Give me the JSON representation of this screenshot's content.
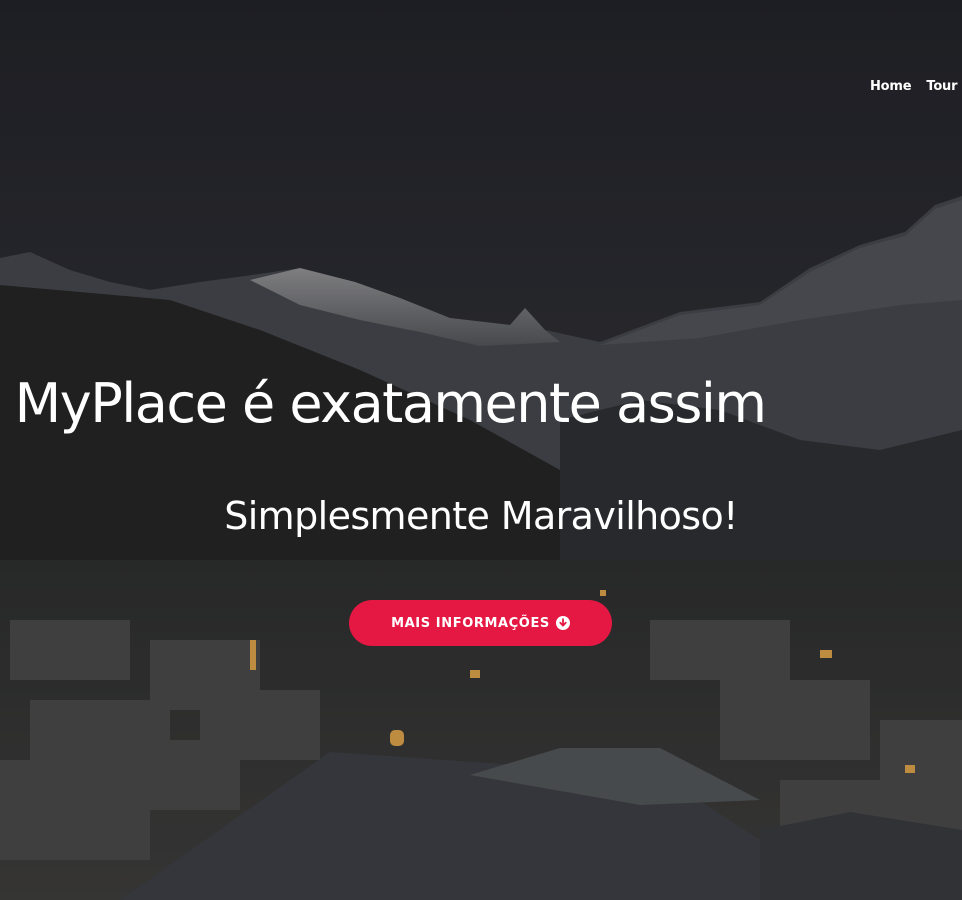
{
  "nav": {
    "items": [
      {
        "label": "Home"
      },
      {
        "label": "Tour"
      }
    ]
  },
  "hero": {
    "headline": "O MyPlace é exatamente assim",
    "subheadline": "Simplesmente Maravilhoso!",
    "cta_label": "MAIS INFORMAÇÕES",
    "cta_icon": "arrow-down-circle-icon",
    "background": "mountain village at dusk"
  },
  "colors": {
    "accent": "#e51844",
    "overlay": "#1f1f24",
    "text": "#ffffff"
  }
}
